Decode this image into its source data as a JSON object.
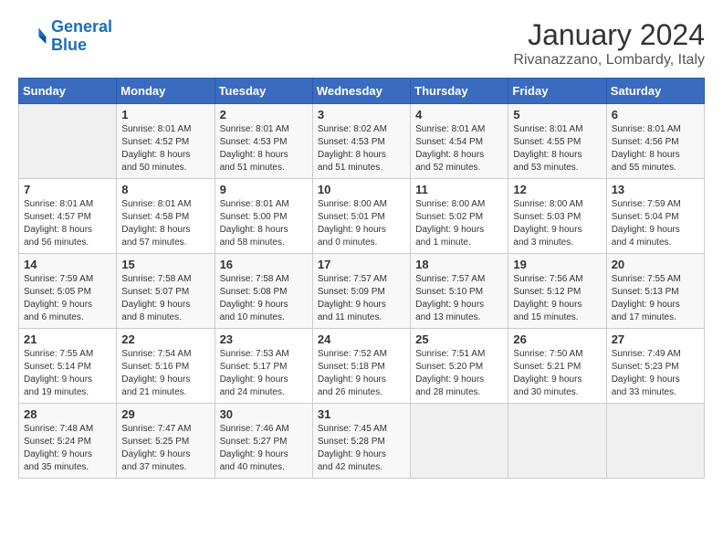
{
  "header": {
    "logo_line1": "General",
    "logo_line2": "Blue",
    "month_year": "January 2024",
    "location": "Rivanazzano, Lombardy, Italy"
  },
  "days_of_week": [
    "Sunday",
    "Monday",
    "Tuesday",
    "Wednesday",
    "Thursday",
    "Friday",
    "Saturday"
  ],
  "weeks": [
    [
      {
        "day": "",
        "info": ""
      },
      {
        "day": "1",
        "info": "Sunrise: 8:01 AM\nSunset: 4:52 PM\nDaylight: 8 hours\nand 50 minutes."
      },
      {
        "day": "2",
        "info": "Sunrise: 8:01 AM\nSunset: 4:53 PM\nDaylight: 8 hours\nand 51 minutes."
      },
      {
        "day": "3",
        "info": "Sunrise: 8:02 AM\nSunset: 4:53 PM\nDaylight: 8 hours\nand 51 minutes."
      },
      {
        "day": "4",
        "info": "Sunrise: 8:01 AM\nSunset: 4:54 PM\nDaylight: 8 hours\nand 52 minutes."
      },
      {
        "day": "5",
        "info": "Sunrise: 8:01 AM\nSunset: 4:55 PM\nDaylight: 8 hours\nand 53 minutes."
      },
      {
        "day": "6",
        "info": "Sunrise: 8:01 AM\nSunset: 4:56 PM\nDaylight: 8 hours\nand 55 minutes."
      }
    ],
    [
      {
        "day": "7",
        "info": "Sunrise: 8:01 AM\nSunset: 4:57 PM\nDaylight: 8 hours\nand 56 minutes."
      },
      {
        "day": "8",
        "info": "Sunrise: 8:01 AM\nSunset: 4:58 PM\nDaylight: 8 hours\nand 57 minutes."
      },
      {
        "day": "9",
        "info": "Sunrise: 8:01 AM\nSunset: 5:00 PM\nDaylight: 8 hours\nand 58 minutes."
      },
      {
        "day": "10",
        "info": "Sunrise: 8:00 AM\nSunset: 5:01 PM\nDaylight: 9 hours\nand 0 minutes."
      },
      {
        "day": "11",
        "info": "Sunrise: 8:00 AM\nSunset: 5:02 PM\nDaylight: 9 hours\nand 1 minute."
      },
      {
        "day": "12",
        "info": "Sunrise: 8:00 AM\nSunset: 5:03 PM\nDaylight: 9 hours\nand 3 minutes."
      },
      {
        "day": "13",
        "info": "Sunrise: 7:59 AM\nSunset: 5:04 PM\nDaylight: 9 hours\nand 4 minutes."
      }
    ],
    [
      {
        "day": "14",
        "info": "Sunrise: 7:59 AM\nSunset: 5:05 PM\nDaylight: 9 hours\nand 6 minutes."
      },
      {
        "day": "15",
        "info": "Sunrise: 7:58 AM\nSunset: 5:07 PM\nDaylight: 9 hours\nand 8 minutes."
      },
      {
        "day": "16",
        "info": "Sunrise: 7:58 AM\nSunset: 5:08 PM\nDaylight: 9 hours\nand 10 minutes."
      },
      {
        "day": "17",
        "info": "Sunrise: 7:57 AM\nSunset: 5:09 PM\nDaylight: 9 hours\nand 11 minutes."
      },
      {
        "day": "18",
        "info": "Sunrise: 7:57 AM\nSunset: 5:10 PM\nDaylight: 9 hours\nand 13 minutes."
      },
      {
        "day": "19",
        "info": "Sunrise: 7:56 AM\nSunset: 5:12 PM\nDaylight: 9 hours\nand 15 minutes."
      },
      {
        "day": "20",
        "info": "Sunrise: 7:55 AM\nSunset: 5:13 PM\nDaylight: 9 hours\nand 17 minutes."
      }
    ],
    [
      {
        "day": "21",
        "info": "Sunrise: 7:55 AM\nSunset: 5:14 PM\nDaylight: 9 hours\nand 19 minutes."
      },
      {
        "day": "22",
        "info": "Sunrise: 7:54 AM\nSunset: 5:16 PM\nDaylight: 9 hours\nand 21 minutes."
      },
      {
        "day": "23",
        "info": "Sunrise: 7:53 AM\nSunset: 5:17 PM\nDaylight: 9 hours\nand 24 minutes."
      },
      {
        "day": "24",
        "info": "Sunrise: 7:52 AM\nSunset: 5:18 PM\nDaylight: 9 hours\nand 26 minutes."
      },
      {
        "day": "25",
        "info": "Sunrise: 7:51 AM\nSunset: 5:20 PM\nDaylight: 9 hours\nand 28 minutes."
      },
      {
        "day": "26",
        "info": "Sunrise: 7:50 AM\nSunset: 5:21 PM\nDaylight: 9 hours\nand 30 minutes."
      },
      {
        "day": "27",
        "info": "Sunrise: 7:49 AM\nSunset: 5:23 PM\nDaylight: 9 hours\nand 33 minutes."
      }
    ],
    [
      {
        "day": "28",
        "info": "Sunrise: 7:48 AM\nSunset: 5:24 PM\nDaylight: 9 hours\nand 35 minutes."
      },
      {
        "day": "29",
        "info": "Sunrise: 7:47 AM\nSunset: 5:25 PM\nDaylight: 9 hours\nand 37 minutes."
      },
      {
        "day": "30",
        "info": "Sunrise: 7:46 AM\nSunset: 5:27 PM\nDaylight: 9 hours\nand 40 minutes."
      },
      {
        "day": "31",
        "info": "Sunrise: 7:45 AM\nSunset: 5:28 PM\nDaylight: 9 hours\nand 42 minutes."
      },
      {
        "day": "",
        "info": ""
      },
      {
        "day": "",
        "info": ""
      },
      {
        "day": "",
        "info": ""
      }
    ]
  ]
}
